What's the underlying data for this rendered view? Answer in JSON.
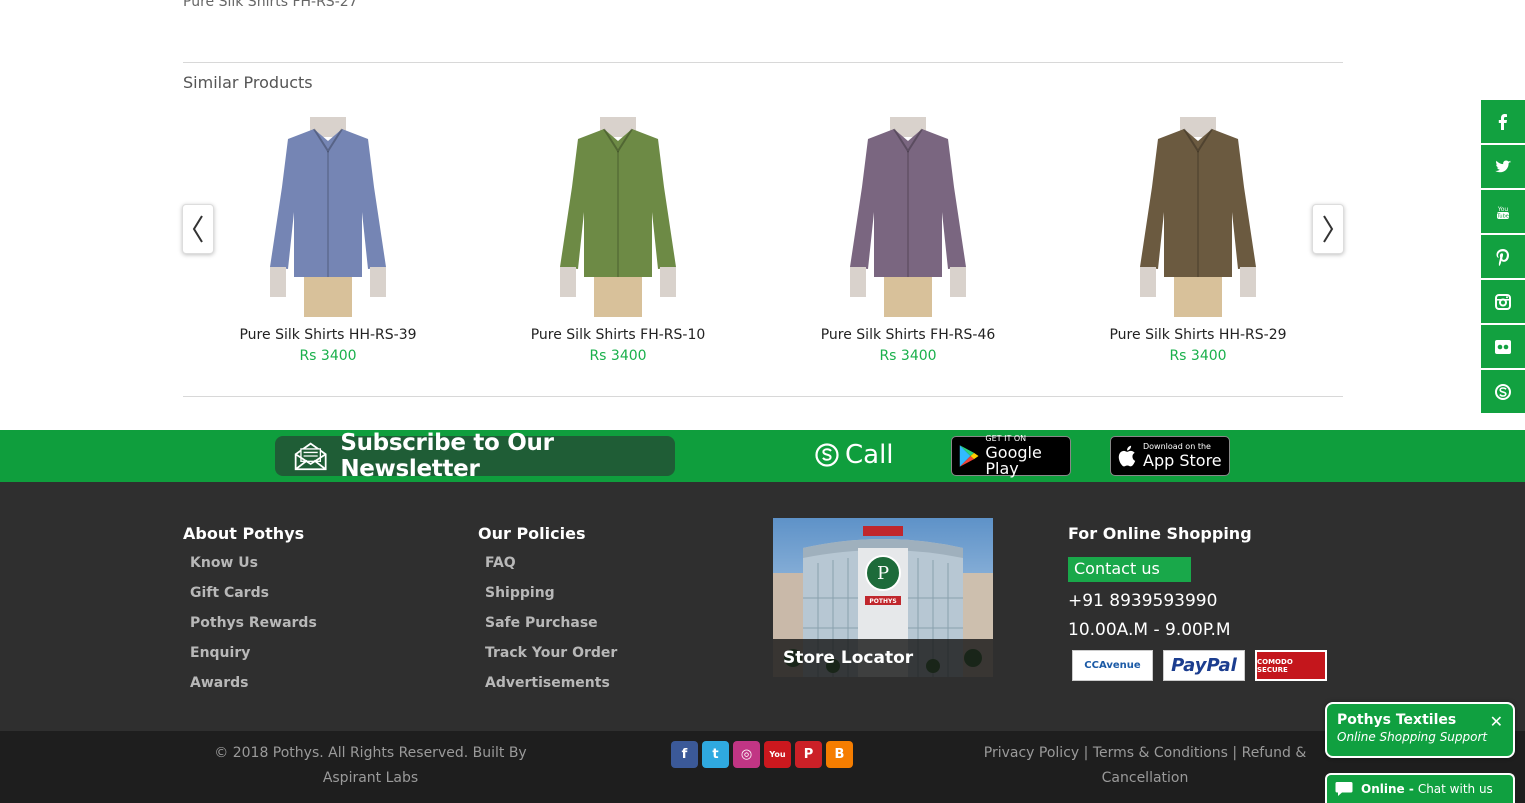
{
  "page": {
    "product_title": "Pure Silk Shirts FH-RS-27"
  },
  "similar": {
    "title": "Similar Products",
    "products": [
      {
        "name": "Pure Silk Shirts HH-RS-39",
        "price": "Rs 3400",
        "shirt_color": "#7585b4"
      },
      {
        "name": "Pure Silk Shirts FH-RS-10",
        "price": "Rs 3400",
        "shirt_color": "#6d8a45"
      },
      {
        "name": "Pure Silk Shirts FH-RS-46",
        "price": "Rs 3400",
        "shirt_color": "#7a6680"
      },
      {
        "name": "Pure Silk Shirts HH-RS-29",
        "price": "Rs 3400",
        "shirt_color": "#6b5a40"
      }
    ]
  },
  "social_sidebar": [
    "facebook-icon",
    "twitter-icon",
    "youtube-icon",
    "pinterest-icon",
    "instagram-icon",
    "flickr-icon",
    "skype-icon"
  ],
  "band": {
    "newsletter": "Subscribe to Our Newsletter",
    "call": "Call",
    "google_play_small": "GET IT ON",
    "google_play_big": "Google Play",
    "app_store_small": "Download on the",
    "app_store_big": "App Store"
  },
  "footer": {
    "about": {
      "title": "About Pothys",
      "links": [
        "Know Us",
        "Gift Cards",
        "Pothys Rewards",
        "Enquiry",
        "Awards"
      ]
    },
    "policies": {
      "title": "Our Policies",
      "links": [
        "FAQ",
        "Shipping",
        "Safe Purchase",
        "Track Your Order",
        "Advertisements"
      ]
    },
    "store_locator": "Store Locator",
    "online": {
      "title": "For Online Shopping",
      "contact": "Contact us",
      "phone": "+91 8939593990",
      "hours": "10.00A.M - 9.00P.M",
      "payments": [
        "CCAvenue",
        "PayPal",
        "COMODO SECURE"
      ]
    }
  },
  "bottom": {
    "copyright": "© 2018 Pothys. All Rights Reserved. Built By Aspirant Labs",
    "privacy": "Privacy Policy",
    "terms": "Terms & Conditions",
    "refund": "Refund & Cancellation"
  },
  "chat": {
    "title": "Pothys Textiles",
    "subtitle": "Online Shopping Support",
    "status": "Online -",
    "cta": "Chat with us"
  },
  "colors": {
    "brand_green": "#0f9e3d",
    "price_green": "#19b04b",
    "footer_bg": "#2f2f2f"
  }
}
